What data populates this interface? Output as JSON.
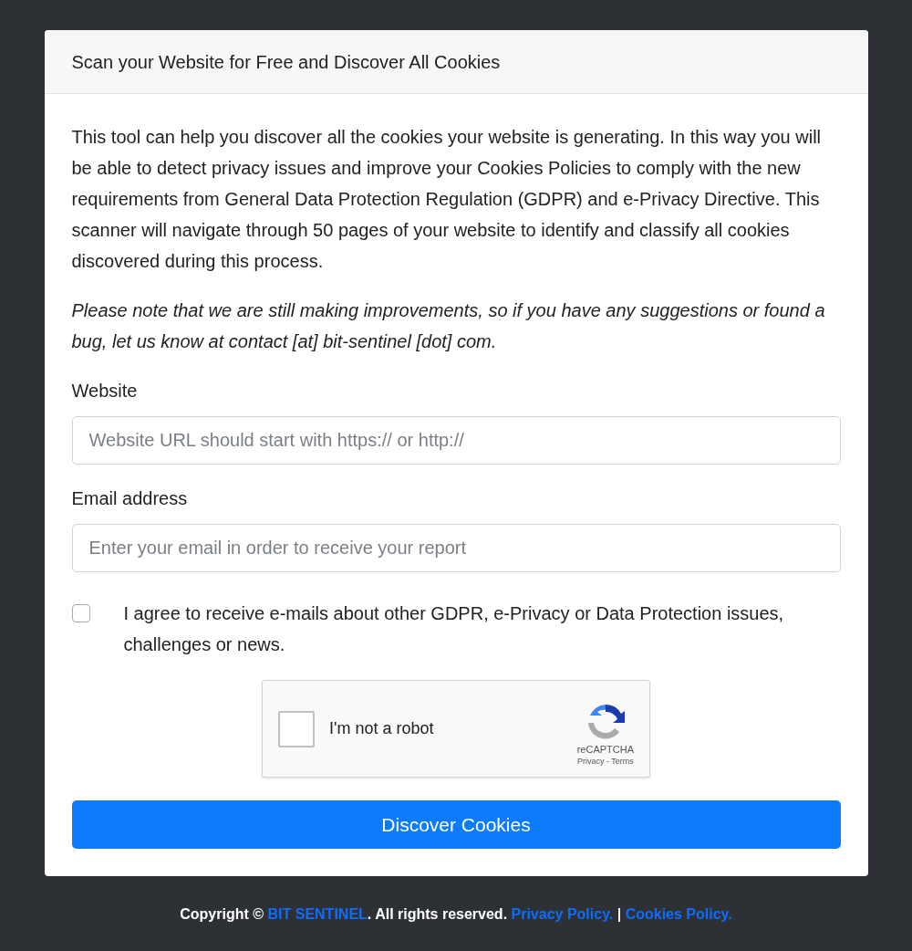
{
  "card": {
    "title": "Scan your Website for Free and Discover All Cookies",
    "intro": "This tool can help you discover all the cookies your website is generating. In this way you will be able to detect privacy issues and improve your Cookies Policies to comply with the new requirements from General Data Protection Regulation (GDPR) and e-Privacy Directive. This scanner will navigate through 50 pages of your website to identify and classify all cookies discovered during this process.",
    "note": "Please note that we are still making improvements, so if you have any suggestions or found a bug, let us know at contact [at] bit-sentinel [dot] com.",
    "fields": [
      {
        "label": "Website",
        "placeholder": "Website URL should start with https:// or http://"
      },
      {
        "label": "Email address",
        "placeholder": "Enter your email in order to receive your report"
      }
    ],
    "consent": {
      "checked": false,
      "label": "I agree to receive e-mails about other GDPR, e-Privacy or Data Protection issues, challenges or news."
    },
    "captcha": {
      "checked": false,
      "label": "I'm not a robot",
      "brand": "reCAPTCHA",
      "links": "Privacy - Terms"
    },
    "submit": "Discover Cookies"
  },
  "footer": [
    {
      "kind": "text",
      "text": "Copyright © "
    },
    {
      "kind": "link",
      "text": "BIT SENTINEL"
    },
    {
      "kind": "text",
      "text": ". All rights reserved. "
    },
    {
      "kind": "link",
      "text": "Privacy Policy."
    },
    {
      "kind": "text",
      "text": " | "
    },
    {
      "kind": "link",
      "text": "Cookies Policy."
    }
  ]
}
